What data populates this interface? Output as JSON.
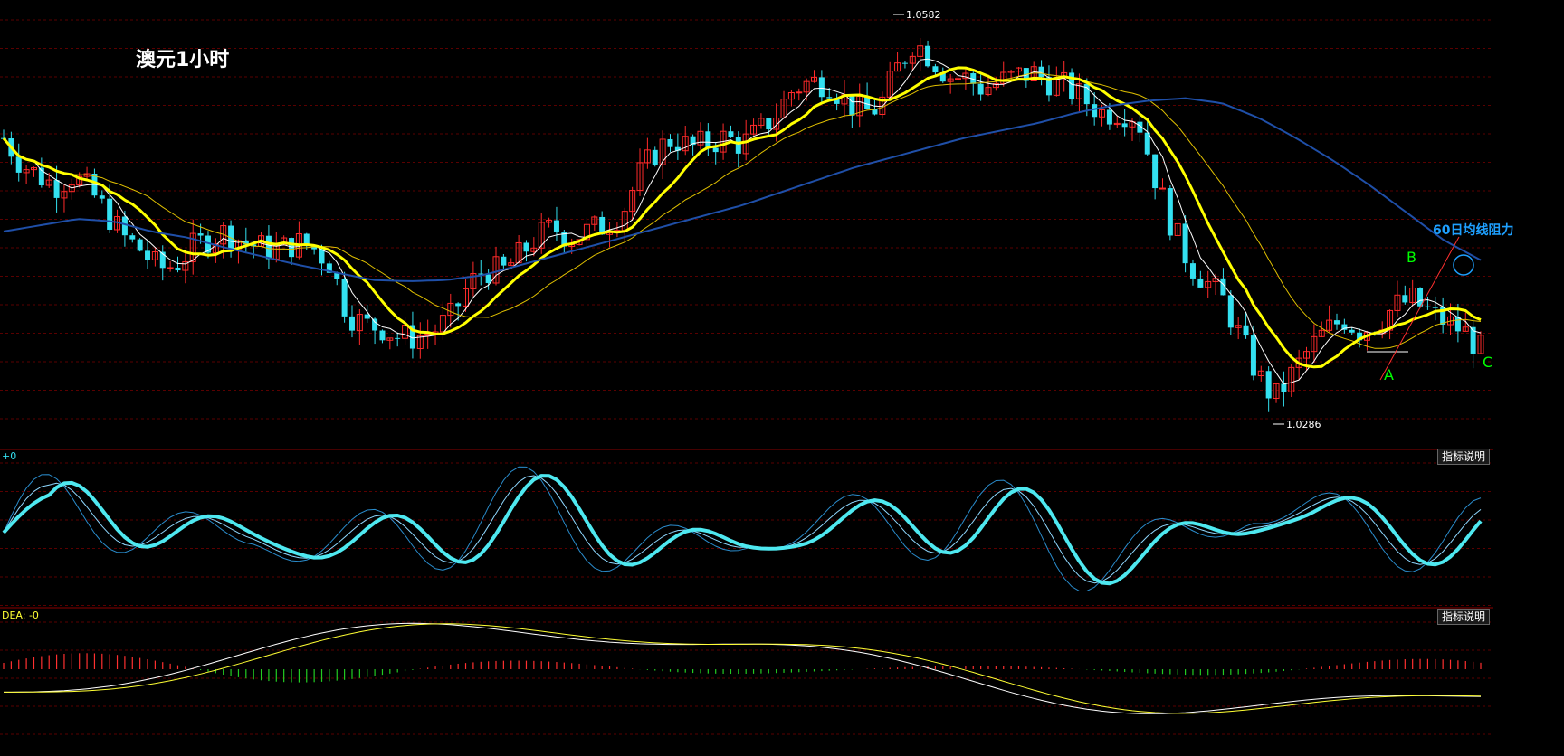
{
  "title": "澳元1小时",
  "annotations": {
    "high_label": "1.0582",
    "low_label": "1.0286",
    "resistance_label": "60日均线阻力",
    "point_a": "A",
    "point_b": "B",
    "point_c": "C"
  },
  "panels": {
    "oscillator_corner": "+0",
    "macd_corner": "DEA: -0",
    "indicator_help_1": "指标说明",
    "indicator_help_2": "指标说明"
  },
  "colors": {
    "background": "#000000",
    "grid": "#5a0000",
    "up_candle": "#ff2a2a",
    "down_candle": "#33e0f0",
    "ma_short": "#ffffff",
    "ma_mid": "#ffff00",
    "ma_long": "#e0c000",
    "ma60": "#1f4fa8",
    "osc_main": "#4ee8f0",
    "osc_fast": "#2a8ccc",
    "macd_diff": "#ffffff",
    "macd_dea": "#ffff33",
    "hist_pos": "#ff3030",
    "hist_neg": "#22cc22",
    "label_green": "#00ff00",
    "label_blue": "#1ea0ff"
  },
  "chart_data": {
    "type": "line",
    "title": "澳元1小时",
    "price_range": [
      1.0255,
      1.06
    ],
    "extremes": {
      "high": 1.0582,
      "low": 1.0286
    },
    "series": [
      {
        "name": "close",
        "values": [
          1.05,
          1.048,
          1.047,
          1.0462,
          1.047,
          1.0458,
          1.044,
          1.042,
          1.041,
          1.0395,
          1.0398,
          1.0412,
          1.042,
          1.0425,
          1.0416,
          1.0412,
          1.041,
          1.0416,
          1.0412,
          1.04,
          1.036,
          1.035,
          1.0348,
          1.034,
          1.034,
          1.0345,
          1.0355,
          1.038,
          1.0395,
          1.0392,
          1.0405,
          1.042,
          1.0428,
          1.042,
          1.0425,
          1.043,
          1.044,
          1.047,
          1.049,
          1.05,
          1.0492,
          1.0496,
          1.05,
          1.0495,
          1.0505,
          1.052,
          1.054,
          1.0545,
          1.0545,
          1.053,
          1.052,
          1.0525,
          1.0555,
          1.0578,
          1.0565,
          1.055,
          1.0548,
          1.054,
          1.0545,
          1.055,
          1.0552,
          1.0545,
          1.054,
          1.053,
          1.052,
          1.0522,
          1.0518,
          1.047,
          1.043,
          1.04,
          1.0385,
          1.037,
          1.034,
          1.031,
          1.029,
          1.031,
          1.033,
          1.0345,
          1.0355,
          1.0345,
          1.0352,
          1.0365,
          1.037,
          1.036,
          1.0352,
          1.0345,
          1.033
        ]
      },
      {
        "name": "MA60",
        "values": [
          1.0425,
          1.043,
          1.0435,
          1.0433,
          1.0425,
          1.042,
          1.0412,
          1.0405,
          1.0398,
          1.0392,
          1.0386,
          1.0385,
          1.0386,
          1.039,
          1.0398,
          1.0406,
          1.0414,
          1.0422,
          1.043,
          1.0438,
          1.0446,
          1.0456,
          1.0466,
          1.0476,
          1.0484,
          1.0492,
          1.05,
          1.0506,
          1.0512,
          1.052,
          1.0526,
          1.053,
          1.0532,
          1.0528,
          1.0516,
          1.05,
          1.0482,
          1.0462,
          1.044,
          1.0418,
          1.0402
        ]
      }
    ],
    "oscillator": {
      "range": [
        0,
        100
      ]
    },
    "macd": {
      "dea_label": "DEA: -0"
    }
  }
}
